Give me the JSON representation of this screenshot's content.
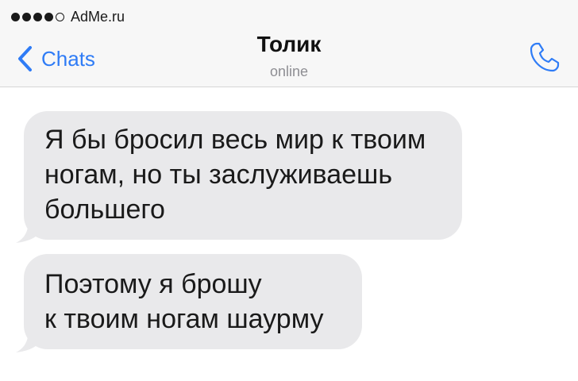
{
  "status_bar": {
    "signal_dots_filled": 4,
    "signal_dots_total": 5,
    "carrier": "AdMe.ru"
  },
  "nav": {
    "back_label": "Chats",
    "contact_name": "Толик",
    "contact_status": "online",
    "call_icon": "phone-icon"
  },
  "messages": [
    {
      "direction": "incoming",
      "lines": [
        "Я бы бросил весь мир к твоим",
        "ногам, но ты заслуживаешь",
        "большего"
      ]
    },
    {
      "direction": "incoming",
      "lines": [
        "Поэтому я брошу",
        "к твоим ногам шаурму"
      ]
    }
  ],
  "colors": {
    "accent": "#2f7cf6",
    "bubble_incoming": "#e9e9eb",
    "header_bg": "#f7f7f7"
  }
}
